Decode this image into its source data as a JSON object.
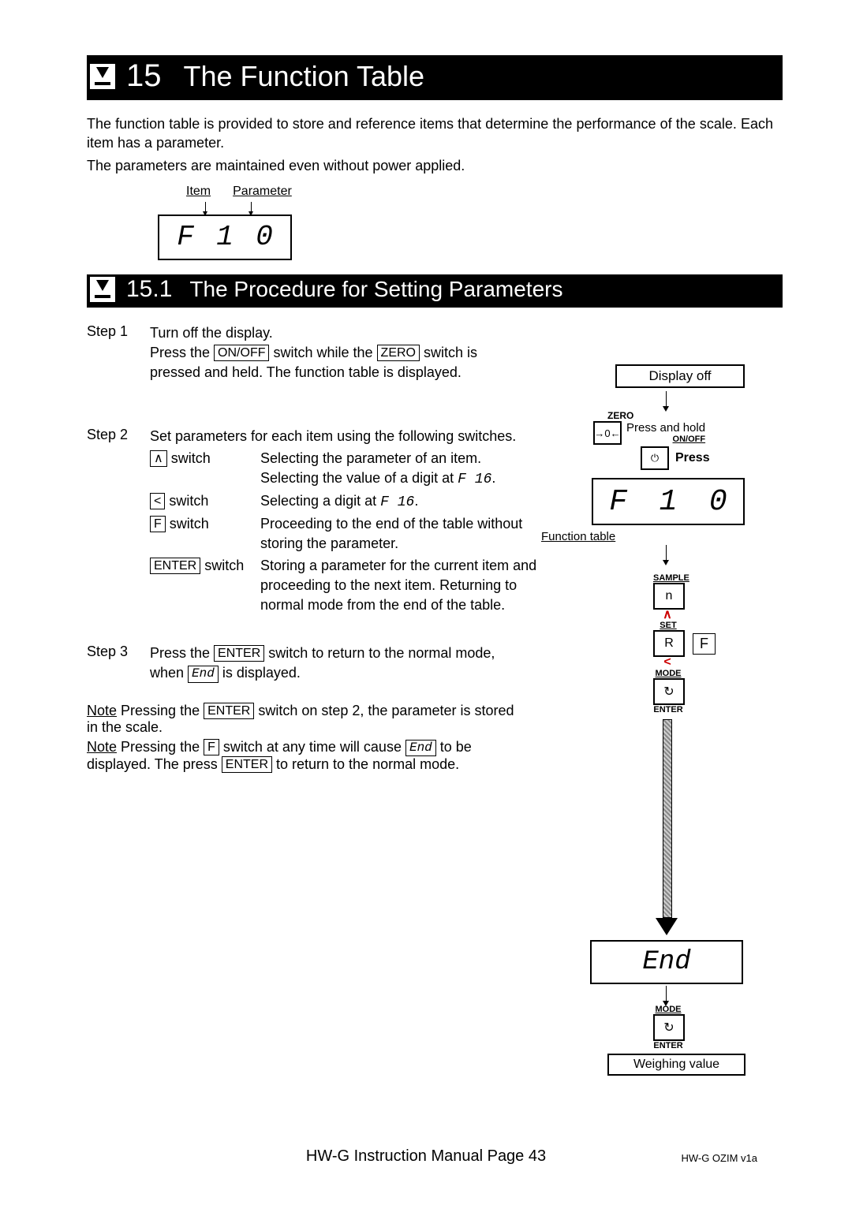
{
  "heading1": {
    "num": "15",
    "title": "The Function Table"
  },
  "intro_p1": "The function table is provided to store and reference items that determine the performance of the scale. Each item has a parameter.",
  "intro_p2": "The parameters are maintained even without power applied.",
  "top_diagram": {
    "label_item": "Item",
    "label_param": "Parameter",
    "seg": {
      "a": "F",
      "b": "1",
      "c": "0"
    }
  },
  "heading2": {
    "num": "15.1",
    "title": "The Procedure for Setting Parameters"
  },
  "steps": {
    "s1": {
      "label": "Step 1",
      "l1a": "Turn off the display.",
      "l2a": "Press the ",
      "l2key1": "ON/OFF",
      "l2b": " switch while the ",
      "l2key2": "ZERO",
      "l2c": " switch is",
      "l3": "pressed and held. The function table is displayed."
    },
    "s2": {
      "label": "Step  2",
      "intro": "Set parameters for each item using the following switches.",
      "rows": [
        {
          "key": "∧",
          "name": " switch",
          "desc": "Selecting the parameter of an item.\nSelecting the value of a digit at F 16."
        },
        {
          "key": "<",
          "name": " switch",
          "desc": "Selecting a digit at F 16."
        },
        {
          "key": "F",
          "name": " switch",
          "desc": "Proceeding to the end of the table without storing the parameter."
        },
        {
          "key": "ENTER",
          "name": " switch",
          "desc": "Storing a parameter for the current item and proceeding to the next item. Returning to normal mode from the end of the table."
        }
      ]
    },
    "s3": {
      "label": "Step  3",
      "a": "Press the ",
      "key": "ENTER",
      "b": " switch to return to the normal mode,",
      "c": "when ",
      "seg": "End",
      "d": " is displayed."
    }
  },
  "notes": {
    "n1a": "Note",
    "n1b": " Pressing the ",
    "n1key": "ENTER",
    "n1c": " switch on step 2, the parameter is stored in the scale.",
    "n2a": "Note",
    "n2b": " Pressing the ",
    "n2key1": "F",
    "n2c": " switch at any time will cause ",
    "n2seg": "End",
    "n2d": " to be displayed. The press ",
    "n2key2": "ENTER",
    "n2e": " to return to the normal mode."
  },
  "flow": {
    "display_off": "Display off",
    "zero": "ZERO",
    "press_hold": "Press and hold",
    "on_off": "ON/OFF",
    "press": "Press",
    "seg": {
      "a": "F",
      "b": "1",
      "c": "0"
    },
    "func_table": "Function table",
    "sample": "SAMPLE",
    "set": "SET",
    "f": "F",
    "mode": "MODE",
    "enter": "ENTER",
    "end": "End",
    "weighing": "Weighing value"
  },
  "footer": {
    "main": "HW-G Instruction Manual Page 43",
    "small": "HW-G OZIM v1a"
  }
}
